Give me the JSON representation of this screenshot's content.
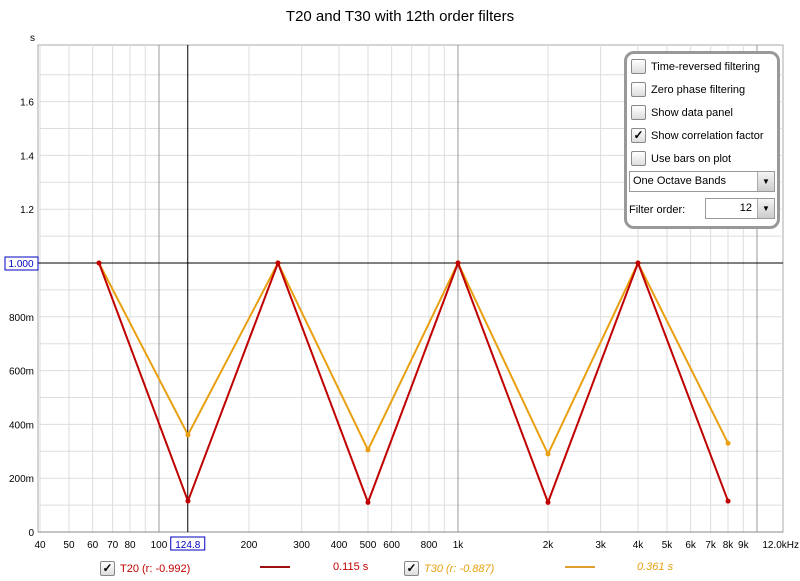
{
  "chart_data": {
    "type": "line",
    "title": "T20 and T30 with 12th order filters",
    "ylabel": "s",
    "xlabel": "",
    "xscale": "log",
    "xlim": [
      40,
      12000
    ],
    "ylim": [
      0,
      1.8
    ],
    "grid": true,
    "x": [
      63,
      125,
      250,
      500,
      1000,
      2000,
      4000,
      8000
    ],
    "x_tick_labels": [
      "40",
      "50",
      "60",
      "70",
      "80",
      "100",
      "200",
      "300",
      "400",
      "500",
      "600",
      "800",
      "1k",
      "2k",
      "3k",
      "4k",
      "5k",
      "6k",
      "7k",
      "8k",
      "9k",
      "12.0kHz"
    ],
    "x_tick_values": [
      40,
      50,
      60,
      70,
      80,
      100,
      200,
      300,
      400,
      500,
      600,
      800,
      1000,
      2000,
      3000,
      4000,
      5000,
      6000,
      7000,
      8000,
      9000,
      12000
    ],
    "y_tick_labels": [
      "0",
      "200m",
      "400m",
      "600m",
      "800m",
      "1.2",
      "1.4",
      "1.6"
    ],
    "y_tick_values": [
      0,
      0.2,
      0.4,
      0.6,
      0.8,
      1.2,
      1.4,
      1.6
    ],
    "cursor": {
      "x_label": "124.8",
      "y_label": "1.000",
      "x": 124.8,
      "y": 1.0
    },
    "series": [
      {
        "name": "T20",
        "color": "#c00000",
        "values": [
          1.0,
          0.115,
          1.0,
          0.11,
          1.0,
          0.11,
          1.0,
          0.115
        ]
      },
      {
        "name": "T30",
        "color": "#e8a010",
        "values": [
          1.0,
          0.361,
          1.0,
          0.305,
          1.0,
          0.29,
          1.0,
          0.33
        ]
      }
    ]
  },
  "panel": {
    "options": [
      {
        "label": "Time-reversed filtering",
        "checked": false
      },
      {
        "label": "Zero phase filtering",
        "checked": false
      },
      {
        "label": "Show data panel",
        "checked": false
      },
      {
        "label": "Show correlation factor",
        "checked": true
      },
      {
        "label": "Use bars on plot",
        "checked": false
      }
    ],
    "band_select": "One Octave Bands",
    "filter_order_label": "Filter order:",
    "filter_order": "12"
  },
  "legend": [
    {
      "label": "T20 (r: -0.992)",
      "value": "0.115 s",
      "color": "#c00000",
      "checked": true
    },
    {
      "label": "T30 (r: -0.887)",
      "value": "0.361 s",
      "color": "#e8a010",
      "checked": true
    }
  ]
}
